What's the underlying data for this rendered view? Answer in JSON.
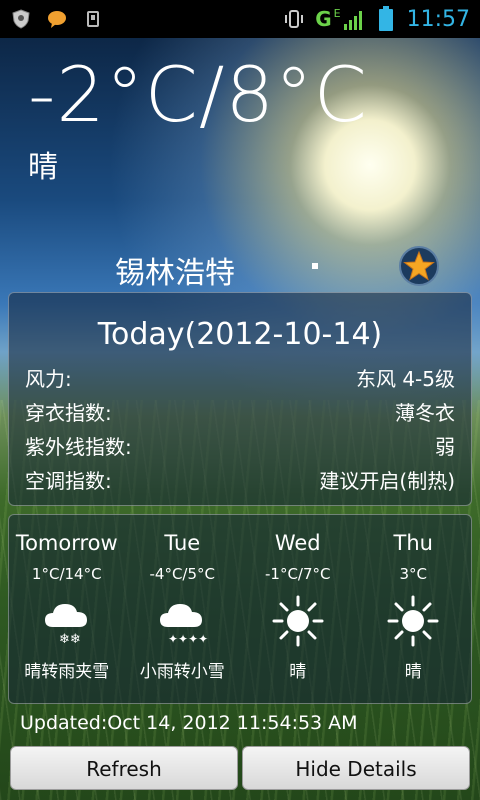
{
  "status_bar": {
    "time": "11:57",
    "network": "G",
    "network_sub": "E",
    "icons": [
      "shield-icon",
      "chat-icon",
      "usb-icon",
      "vibrate-icon",
      "signal-icon",
      "battery-icon"
    ]
  },
  "current": {
    "temperature": "-2°C/8°C",
    "condition": "晴",
    "city": "锡林浩特"
  },
  "today": {
    "title": "Today(2012-10-14)",
    "rows": [
      {
        "label": "风力:",
        "value": "东风 4-5级"
      },
      {
        "label": "穿衣指数:",
        "value": "薄冬衣"
      },
      {
        "label": "紫外线指数:",
        "value": "弱"
      },
      {
        "label": "空调指数:",
        "value": "建议开启(制热)"
      }
    ]
  },
  "forecast": [
    {
      "name": "Tomorrow",
      "temp": "1°C/14°C",
      "icon": "snow-cloud-icon",
      "cond": "晴转雨夹雪"
    },
    {
      "name": "Tue",
      "temp": "-4°C/5°C",
      "icon": "rain-snow-cloud-icon",
      "cond": "小雨转小雪"
    },
    {
      "name": "Wed",
      "temp": "-1°C/7°C",
      "icon": "sun-icon",
      "cond": "晴"
    },
    {
      "name": "Thu",
      "temp": "3°C",
      "icon": "sun-icon",
      "cond": "晴"
    }
  ],
  "updated": "Updated:Oct 14, 2012 11:54:53 AM",
  "buttons": {
    "refresh": "Refresh",
    "hide_details": "Hide Details"
  },
  "colors": {
    "time": "#33b5e5",
    "network": "#6cd24a",
    "star": "#f5a623"
  }
}
